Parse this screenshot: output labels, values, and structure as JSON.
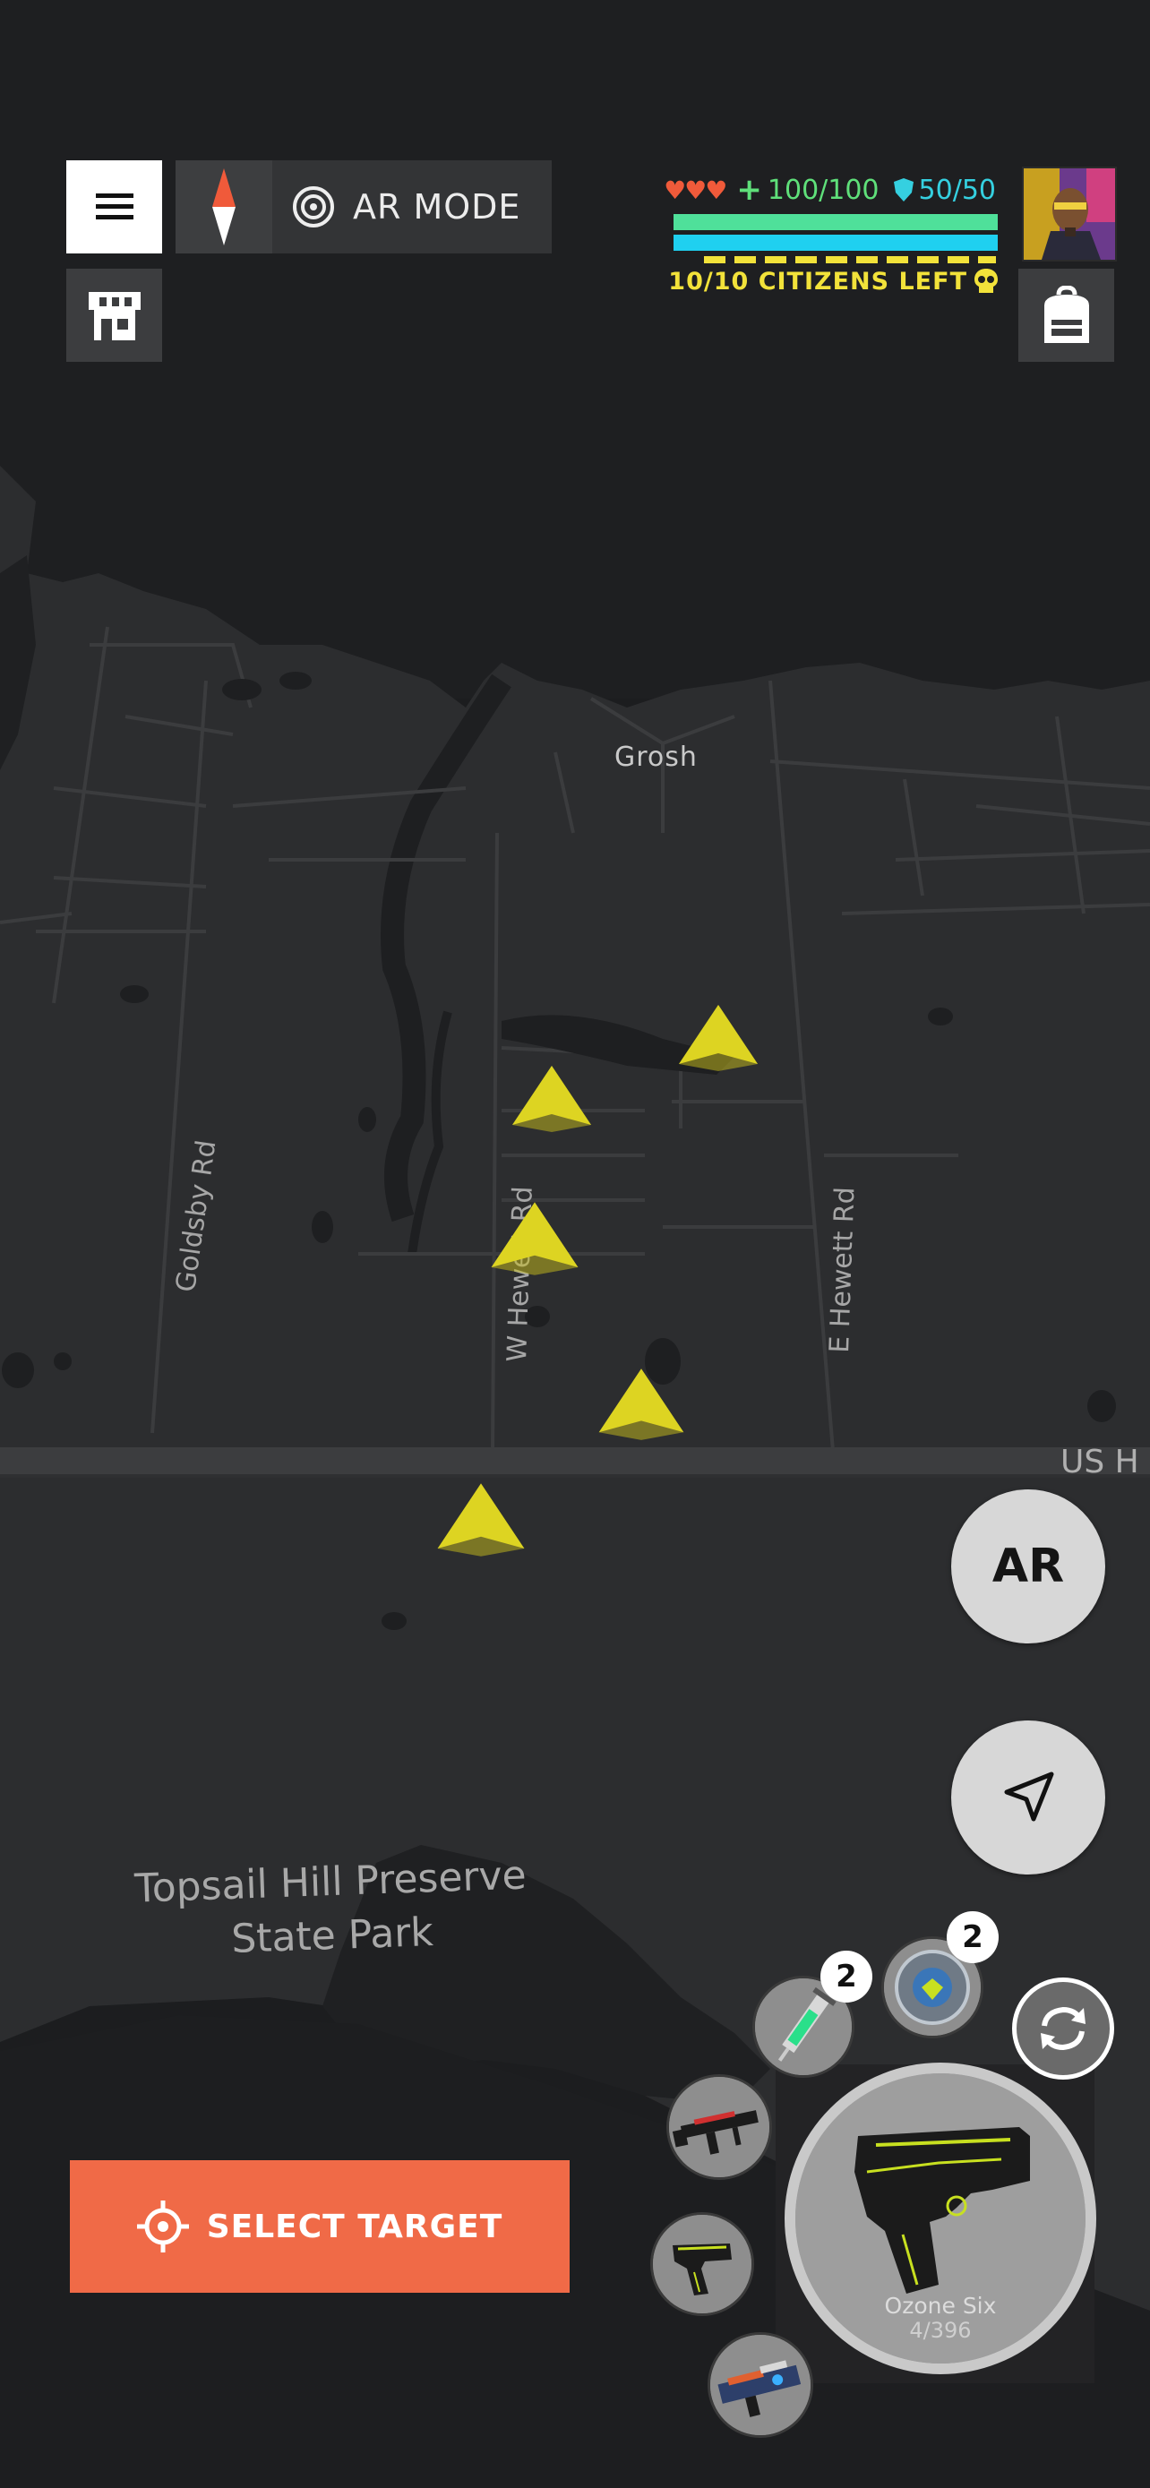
{
  "map": {
    "place_label": "Grosh",
    "park_label_line1": "Topsail Hill Preserve",
    "park_label_line2": "State Park",
    "roads": {
      "goldsby": "Goldsby Rd",
      "w_hewett": "W Hewett Rd",
      "e_hewett": "E Hewett Rd",
      "us_highway": "US H"
    },
    "targets_count": 5
  },
  "header": {
    "ar_mode_label": "AR MODE",
    "hearts": 3,
    "health_text": "100/100",
    "shield_text": "50/50",
    "health_fraction": 1.0,
    "shield_fraction": 1.0,
    "citizens_text": "10/10 CITIZENS LEFT"
  },
  "buttons": {
    "ar_label": "AR",
    "select_target_label": "SELECT TARGET"
  },
  "inventory": {
    "syringe_count": "2",
    "shield_count": "2"
  },
  "weapon": {
    "name": "Ozone Six",
    "ammo": "4/396"
  },
  "colors": {
    "accent_orange": "#f06a47",
    "health_green": "#4fe09a",
    "shield_cyan": "#1fd0f0",
    "citizen_yellow": "#f2e23a",
    "target_yellow": "#f0e828"
  },
  "icons": [
    "hamburger-menu-icon",
    "compass-icon",
    "target-rings-icon",
    "shop-icon",
    "backpack-icon",
    "heart-icon",
    "plus-icon",
    "shield-icon",
    "skull-icon",
    "navigation-arrow-icon",
    "swap-icon",
    "crosshair-icon"
  ]
}
